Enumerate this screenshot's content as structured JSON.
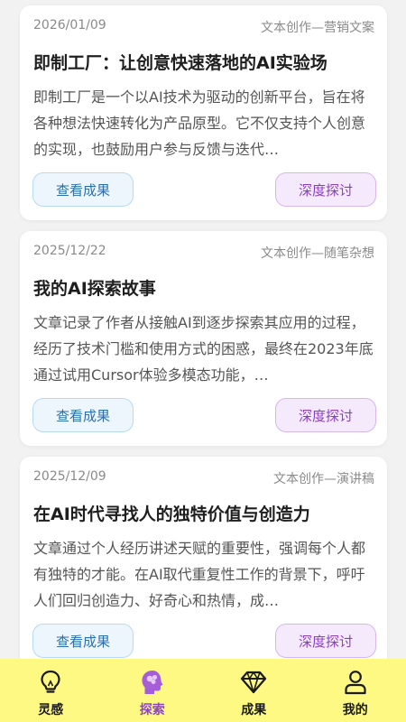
{
  "cards": [
    {
      "date": "2026/01/09",
      "category": "文本创作—营销文案",
      "title": "即制工厂：让创意快速落地的AI实验场",
      "description": "即制工厂是一个以AI技术为驱动的创新平台，旨在将各种想法快速转化为产品原型。它不仅支持个人创意的实现，也鼓励用户参与反馈与迭代…",
      "result_label": "查看成果",
      "discuss_label": "深度探讨"
    },
    {
      "date": "2025/12/22",
      "category": "文本创作—随笔杂想",
      "title": "我的AI探索故事",
      "description": "文章记录了作者从接触AI到逐步探索其应用的过程，经历了技术门槛和使用方式的困惑，最终在2023年底通过试用Cursor体验多模态功能，…",
      "result_label": "查看成果",
      "discuss_label": "深度探讨"
    },
    {
      "date": "2025/12/09",
      "category": "文本创作—演讲稿",
      "title": "在AI时代寻找人的独特价值与创造力",
      "description": "文章通过个人经历讲述天赋的重要性，强调每个人都有独特的才能。在AI取代重复性工作的背景下，呼吁人们回归创造力、好奇心和热情，成…",
      "result_label": "查看成果",
      "discuss_label": "深度探讨"
    }
  ],
  "tabbar": {
    "items": [
      {
        "label": "灵感",
        "icon": "lightbulb-icon"
      },
      {
        "label": "探索",
        "icon": "brain-head-icon"
      },
      {
        "label": "成果",
        "icon": "diamond-icon"
      },
      {
        "label": "我的",
        "icon": "user-icon"
      }
    ],
    "active_index": 1,
    "background": "#fdf983",
    "active_color": "#8e44c9"
  }
}
